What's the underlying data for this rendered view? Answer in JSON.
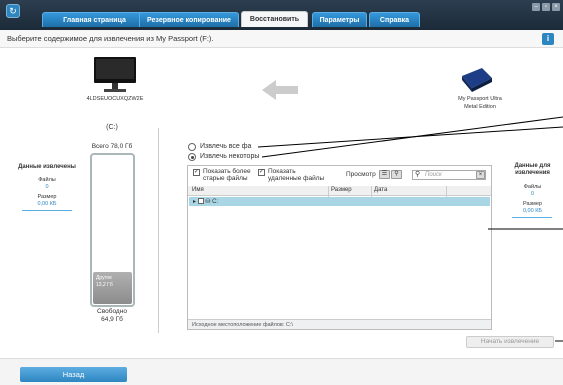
{
  "tabs": [
    {
      "label": "Главная страница",
      "active": false
    },
    {
      "label": "Резервное копирование",
      "active": false
    },
    {
      "label": "Восстановить",
      "active": true
    },
    {
      "label": "Параметры",
      "active": false
    },
    {
      "label": "Справка",
      "active": false
    }
  ],
  "subtitle": "Выберите содержимое для извлечения из My Passport (F:).",
  "info_label": "i",
  "source": {
    "name": "4LDSEUOCUXQZW2E"
  },
  "target": {
    "name_line1": "My Passport Ultra",
    "name_line2": "Metal Edition"
  },
  "drive": {
    "letter": "(C:)",
    "total": "Всего 78,0 Гб",
    "other_line1": "Другое",
    "other_line2": "13,2 Гб",
    "free_label": "Свободно",
    "free_value": "64,9 Гб"
  },
  "left_stats": {
    "title": "Данные извлечены",
    "files_label": "Файлы",
    "files_value": "0",
    "size_label": "Размер",
    "size_value": "0,00 КБ"
  },
  "right_stats": {
    "title_line1": "Данные для",
    "title_line2": "извлечения",
    "files_label": "Файлы",
    "files_value": "0",
    "size_label": "Размер",
    "size_value": "0,00 КБ"
  },
  "options": {
    "all": "Извлечь все фа",
    "some": "Извлечь некоторы"
  },
  "toolbar": {
    "show_old_1": "Показать более",
    "show_old_2": "старые файлы",
    "show_deleted_1": "Показать",
    "show_deleted_2": "удаленные файлы",
    "view_label": "Просмотр",
    "search_placeholder": "Поиск"
  },
  "columns": [
    "Имя",
    "Размер",
    "Дата"
  ],
  "tree_row": "C:",
  "status_text": "Исходное местоположение файлов: C:\\",
  "start_button": "Начать извлечение",
  "back_button": "Назад"
}
